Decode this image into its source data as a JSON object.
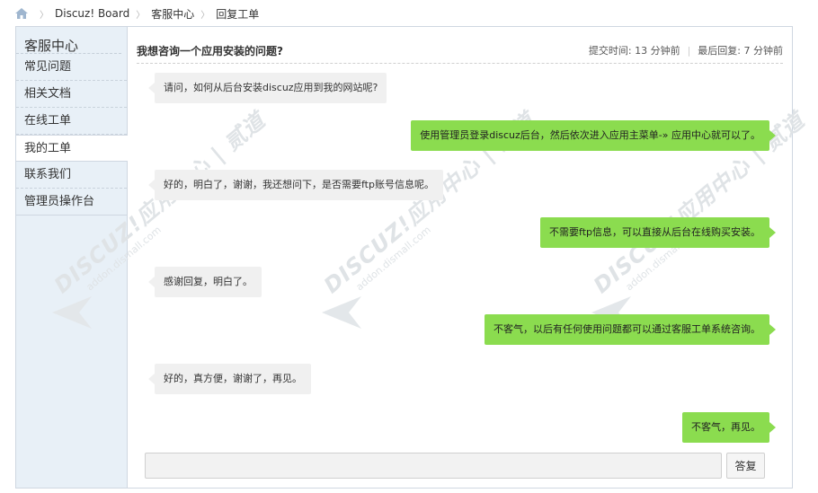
{
  "breadcrumb": {
    "home_icon": "home-icon",
    "items": [
      "Discuz! Board",
      "客服中心",
      "回复工单"
    ]
  },
  "sidebar": {
    "title": "客服中心",
    "items": [
      {
        "label": "常见问题",
        "active": false
      },
      {
        "label": "相关文档",
        "active": false
      },
      {
        "label": "在线工单",
        "active": false
      },
      {
        "label": "我的工单",
        "active": true
      },
      {
        "label": "联系我们",
        "active": false
      },
      {
        "label": "管理员操作台",
        "active": false
      }
    ]
  },
  "thread": {
    "title": "我想咨询一个应用安装的问题?",
    "submit_time": "提交时间: 13 分钟前",
    "last_reply": "最后回复: 7 分钟前"
  },
  "messages": [
    {
      "side": "left",
      "text": "请问，如何从后台安装discuz应用到我的网站呢?"
    },
    {
      "side": "right",
      "text": "使用管理员登录discuz后台，然后依次进入应用主菜单-» 应用中心就可以了。"
    },
    {
      "side": "left",
      "text": "好的，明白了，谢谢，我还想问下，是否需要ftp账号信息呢。"
    },
    {
      "side": "right",
      "text": "不需要ftp信息，可以直接从后台在线购买安装。"
    },
    {
      "side": "left",
      "text": "感谢回复，明白了。"
    },
    {
      "side": "right",
      "text": "不客气，以后有任何使用问题都可以通过客服工单系统咨询。"
    },
    {
      "side": "left",
      "text": "好的，真方便，谢谢了，再见。"
    },
    {
      "side": "right",
      "text": "不客气，再见。"
    }
  ],
  "reply": {
    "placeholder": "",
    "button_label": "答复"
  },
  "watermark": {
    "brand": "DISCUZ!应用中心 | 贰道",
    "url": "addon.dismall.com"
  },
  "colors": {
    "accent_green": "#8bdc4f",
    "bubble_gray": "#f0f0f0",
    "sidebar_bg": "#e8f0f7"
  }
}
